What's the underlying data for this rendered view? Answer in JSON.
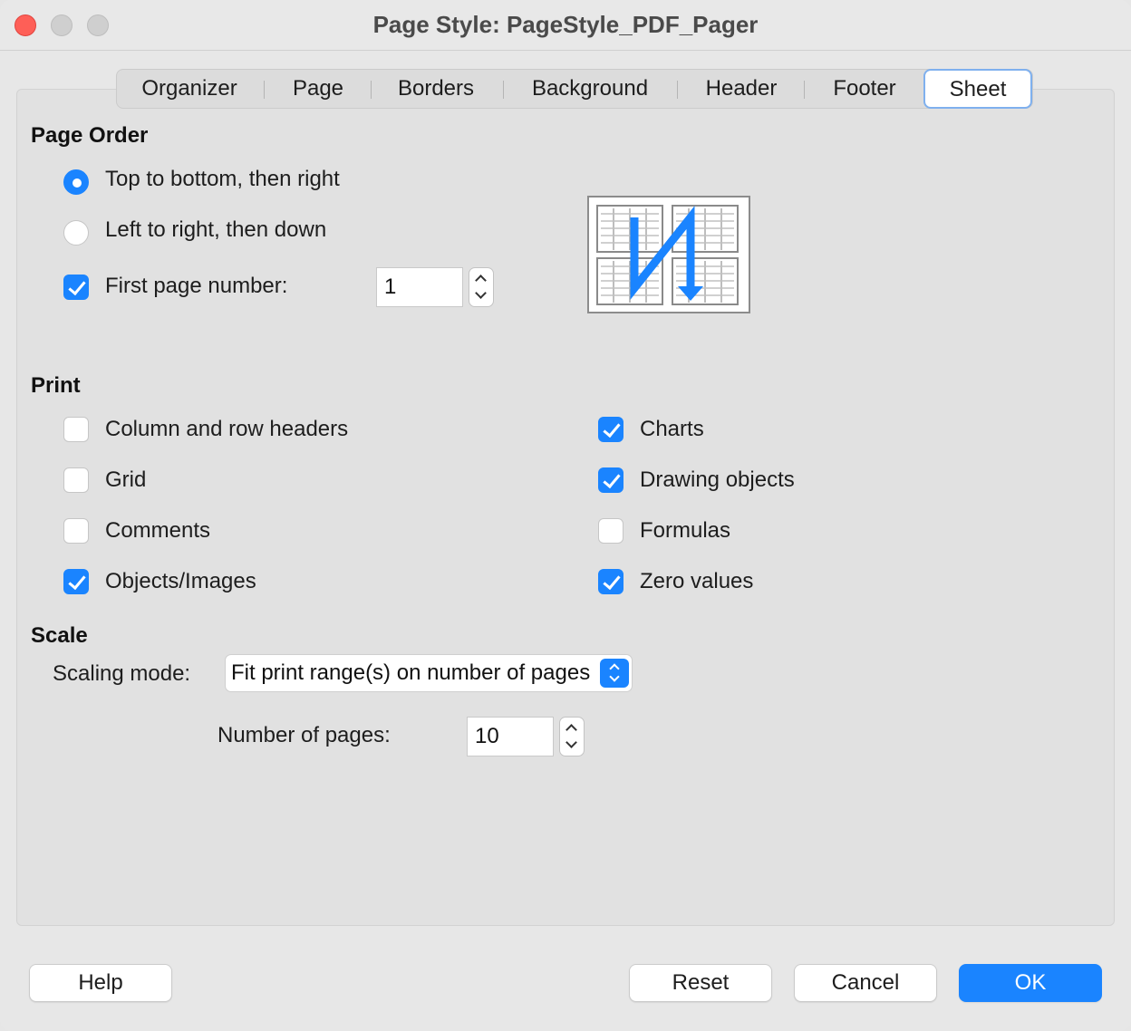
{
  "window": {
    "title": "Page Style: PageStyle_PDF_Pager"
  },
  "tabs": [
    {
      "label": "Organizer"
    },
    {
      "label": "Page"
    },
    {
      "label": "Borders"
    },
    {
      "label": "Background"
    },
    {
      "label": "Header"
    },
    {
      "label": "Footer"
    },
    {
      "label": "Sheet",
      "active": true
    }
  ],
  "page_order": {
    "heading": "Page Order",
    "top_to_bottom_label": "Top to bottom, then right",
    "top_to_bottom_selected": true,
    "left_to_right_label": "Left to right, then down",
    "left_to_right_selected": false,
    "first_page_number_label": "First page number:",
    "first_page_number_checked": true,
    "first_page_number_value": "1"
  },
  "print": {
    "heading": "Print",
    "column_row_headers": {
      "label": "Column and row headers",
      "checked": false
    },
    "grid": {
      "label": "Grid",
      "checked": false
    },
    "comments": {
      "label": "Comments",
      "checked": false
    },
    "objects_images": {
      "label": "Objects/Images",
      "checked": true
    },
    "charts": {
      "label": "Charts",
      "checked": true
    },
    "drawing_objects": {
      "label": "Drawing objects",
      "checked": true
    },
    "formulas": {
      "label": "Formulas",
      "checked": false
    },
    "zero_values": {
      "label": "Zero values",
      "checked": true
    }
  },
  "scale": {
    "heading": "Scale",
    "scaling_mode_label": "Scaling mode:",
    "scaling_mode_value": "Fit print range(s) on number of pages",
    "number_of_pages_label": "Number of pages:",
    "number_of_pages_value": "10"
  },
  "buttons": {
    "help": "Help",
    "reset": "Reset",
    "cancel": "Cancel",
    "ok": "OK"
  },
  "colors": {
    "accent": "#1a84ff",
    "close": "#fe5f57"
  }
}
